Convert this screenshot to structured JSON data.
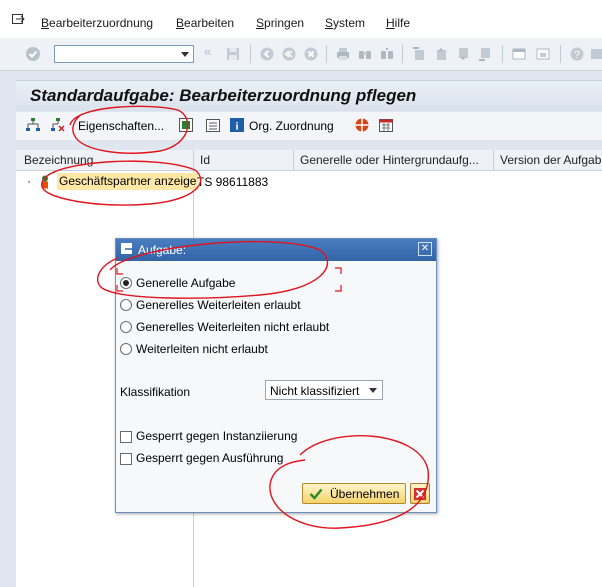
{
  "menu": {
    "items": [
      {
        "first": "B",
        "rest": "earbeiterzuordnung"
      },
      {
        "first": "B",
        "rest": "earbeiten"
      },
      {
        "first": "S",
        "rest": "pringen"
      },
      {
        "first": "S",
        "rest": "ystem"
      },
      {
        "first": "H",
        "rest": "ilfe"
      }
    ]
  },
  "command_field": {
    "value": ""
  },
  "title": "Standardaufgabe: Bearbeiterzuordnung pflegen",
  "app_toolbar": {
    "properties_label": "Eigenschaften...",
    "org_label": "Org. Zuordnung"
  },
  "grid": {
    "columns": [
      "Bezeichnung",
      "Id",
      "Generelle oder Hintergrundaufg...",
      "Version der Aufgab"
    ],
    "node_bullet": "·",
    "node_label": "Geschäftspartner anzeige",
    "node_id": "TS 98611883"
  },
  "dialog": {
    "title": "Aufgabe:",
    "radios": [
      {
        "label": "Generelle Aufgabe",
        "selected": true
      },
      {
        "label": "Generelles Weiterleiten erlaubt",
        "selected": false
      },
      {
        "label": "Generelles Weiterleiten nicht erlaubt",
        "selected": false
      },
      {
        "label": "Weiterleiten nicht erlaubt",
        "selected": false
      }
    ],
    "classification_label": "Klassifikation",
    "classification_value": "Nicht klassifiziert",
    "checkboxes": [
      {
        "label": "Gesperrt gegen Instanziierung",
        "checked": false
      },
      {
        "label": "Gesperrt gegen Ausführung",
        "checked": false
      }
    ],
    "ok_label": "Übernehmen"
  },
  "colors": {
    "title_bar": "#3264a8",
    "highlight_node": "#ffe8a5",
    "annotation": "#e0141e"
  }
}
